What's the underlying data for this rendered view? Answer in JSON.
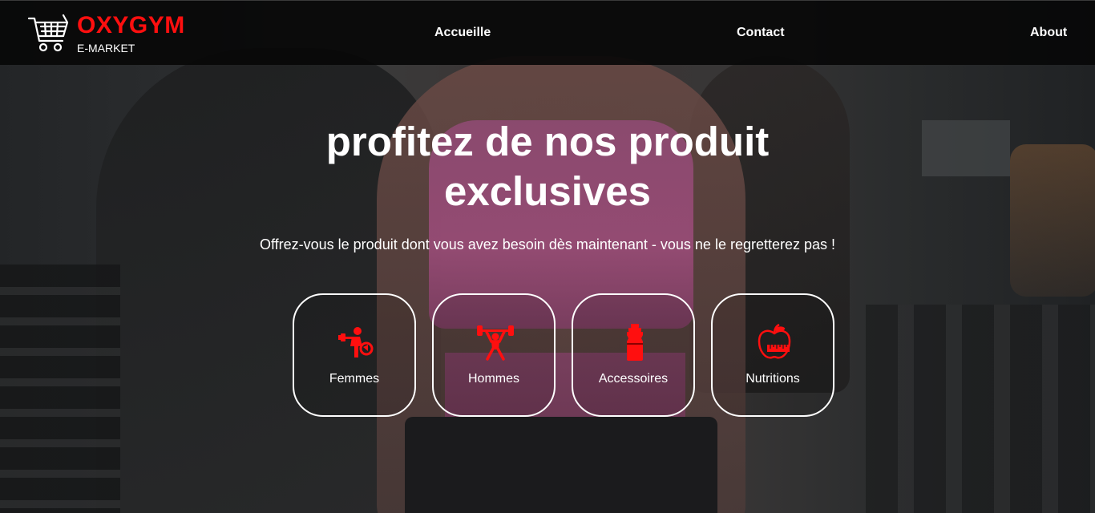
{
  "brand": {
    "name": "OXYGYM",
    "subtitle": "E-MARKET",
    "logo_icon": "shopping-cart-icon",
    "accent_color": "#ff0f0f"
  },
  "nav": {
    "items": [
      {
        "label": "Accueille"
      },
      {
        "label": "Contact"
      },
      {
        "label": "About"
      }
    ]
  },
  "hero": {
    "title_line1": "profitez de nos produit",
    "title_line2": "exclusives",
    "subtitle": "Offrez-vous le produit dont vous avez besoin dès maintenant - vous ne le regretterez pas !"
  },
  "categories": [
    {
      "label": "Femmes",
      "icon": "woman-fitness-icon"
    },
    {
      "label": "Hommes",
      "icon": "weightlifter-icon"
    },
    {
      "label": "Accessoires",
      "icon": "water-bottle-icon"
    },
    {
      "label": "Nutritions",
      "icon": "apple-measuring-tape-icon"
    }
  ]
}
